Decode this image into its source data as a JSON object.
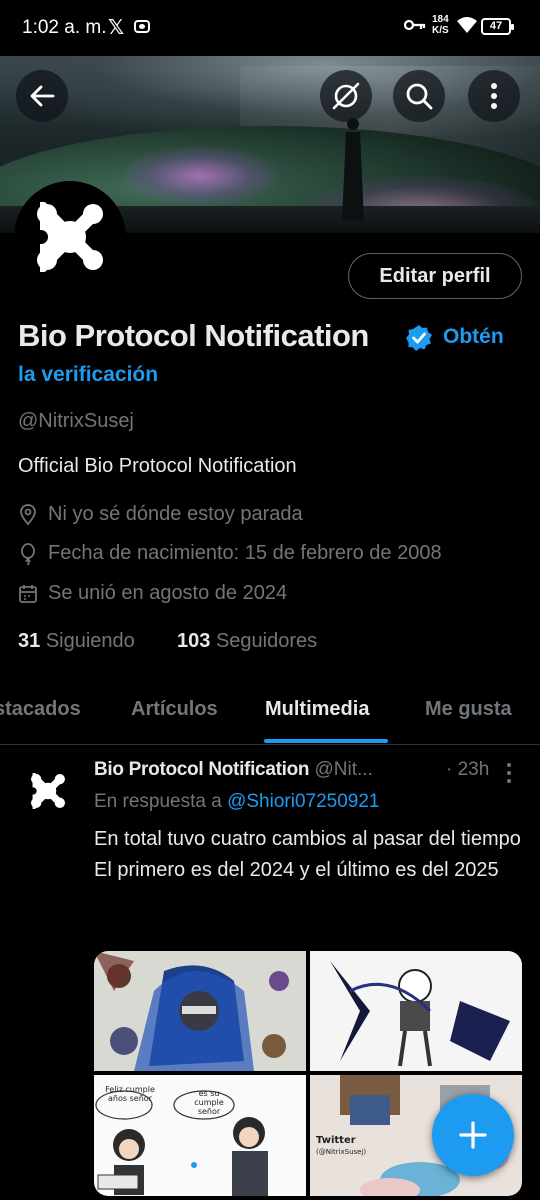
{
  "status_bar": {
    "time": "1:02 a. m.",
    "network_speed_value": "184",
    "network_speed_unit": "K/S",
    "battery": "47"
  },
  "header": {
    "back_icon": "arrow-left-icon",
    "no_translate_icon": "slashed-circle-icon",
    "search_icon": "search-icon",
    "more_icon": "vertical-dots-icon"
  },
  "profile": {
    "display_name": "Bio Protocol Notification",
    "get_verified_line1": "Obtén",
    "get_verified_line2": "la verificación",
    "handle": "@NitrixSusej",
    "bio": "Official Bio Protocol Notification",
    "location": "Ni yo sé dónde estoy parada",
    "birthday": "Fecha de nacimiento: 15 de febrero de 2008",
    "joined": "Se unió en agosto de 2024",
    "following_count": "31",
    "following_label": "Siguiendo",
    "followers_count": "103",
    "followers_label": "Seguidores",
    "edit_profile_label": "Editar perfil"
  },
  "tabs": [
    {
      "label": "stacados"
    },
    {
      "label": "Artículos"
    },
    {
      "label": "Multimedia",
      "active": true
    },
    {
      "label": "Me gusta"
    }
  ],
  "post": {
    "author_name": "Bio Protocol Notification",
    "author_handle": "@Nit...",
    "time": "· 23h",
    "reply_prefix": "En respuesta a",
    "reply_to": "@Shiori07250921",
    "text_line1": "En total tuvo cuatro cambios al pasar del tiempo",
    "text_line2": "El primero es del 2024 y el último es del 2025",
    "media_caption_1": "Feliz cumple años señor",
    "media_caption_2": "es su cumple señor",
    "media_watermark": "Twitter",
    "media_watermark_handle": "(@NitrixSusej)"
  },
  "colors": {
    "accent": "#1d9bf0",
    "background": "#000000",
    "text_primary": "#e7e9ea",
    "text_secondary": "#71767b"
  }
}
